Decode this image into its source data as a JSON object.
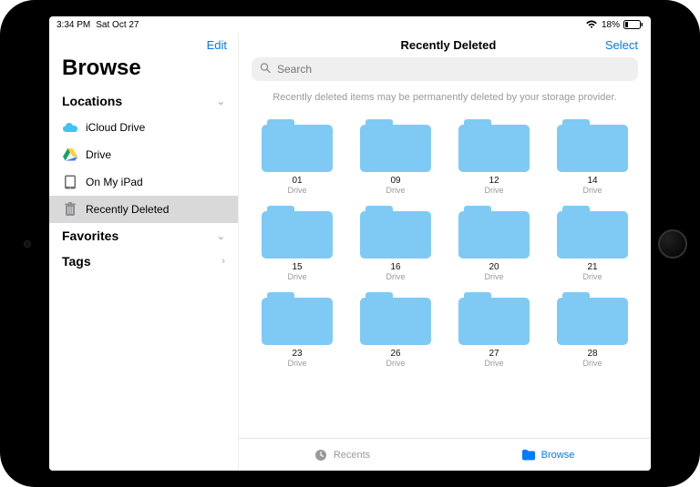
{
  "status": {
    "time": "3:34 PM",
    "date": "Sat Oct 27",
    "battery": "18%"
  },
  "sidebar": {
    "edit": "Edit",
    "title": "Browse",
    "sections": {
      "locations": "Locations",
      "favorites": "Favorites",
      "tags": "Tags"
    },
    "items": [
      {
        "label": "iCloud Drive"
      },
      {
        "label": "Drive"
      },
      {
        "label": "On My iPad"
      },
      {
        "label": "Recently Deleted"
      }
    ]
  },
  "main": {
    "title": "Recently Deleted",
    "select": "Select",
    "search_placeholder": "Search",
    "hint": "Recently deleted items may be permanently deleted by your storage provider."
  },
  "folders": [
    {
      "name": "01",
      "source": "Drive"
    },
    {
      "name": "09",
      "source": "Drive"
    },
    {
      "name": "12",
      "source": "Drive"
    },
    {
      "name": "14",
      "source": "Drive"
    },
    {
      "name": "15",
      "source": "Drive"
    },
    {
      "name": "16",
      "source": "Drive"
    },
    {
      "name": "20",
      "source": "Drive"
    },
    {
      "name": "21",
      "source": "Drive"
    },
    {
      "name": "23",
      "source": "Drive"
    },
    {
      "name": "26",
      "source": "Drive"
    },
    {
      "name": "27",
      "source": "Drive"
    },
    {
      "name": "28",
      "source": "Drive"
    }
  ],
  "bottombar": {
    "recents": "Recents",
    "browse": "Browse"
  }
}
